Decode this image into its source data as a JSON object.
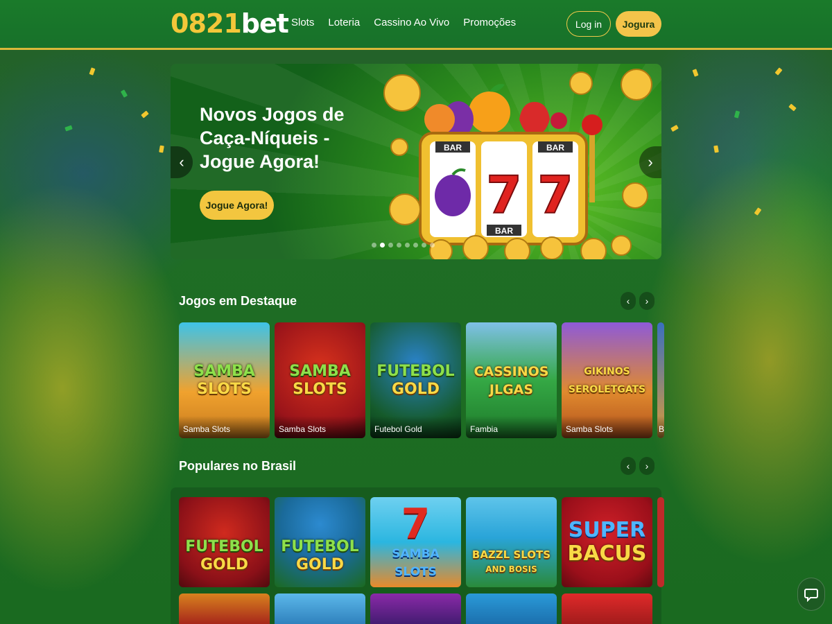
{
  "brand": {
    "logo_num": "0821",
    "logo_bet": "bet"
  },
  "nav": [
    "Slots",
    "Loteria",
    "Cassino Ao Vivo",
    "Promoções"
  ],
  "auth": {
    "login": "Log in",
    "signup": "Jogura"
  },
  "hero": {
    "title": "Novos Jogos de Caça-Níqueis - Jogue Agora!",
    "cta": "Jogue Agora!",
    "slide_count": 8,
    "active_slide": 1,
    "reel_labels": [
      "BAR",
      "BAR",
      "BAR"
    ],
    "reel_symbols": [
      "plum-icon",
      "7",
      "7"
    ]
  },
  "sections": {
    "featured": {
      "title": "Jogos em Destaque",
      "games": [
        {
          "name": "Samba Slots",
          "art": [
            "SAMBA",
            "SLOTS"
          ],
          "bg": "#f0a22e"
        },
        {
          "name": "Samba Slots",
          "art": [
            "SAMBA",
            "SLOTS"
          ],
          "bg": "#a91d1d"
        },
        {
          "name": "Futebol Gold",
          "art": [
            "FUTEBOL",
            "GOLD"
          ],
          "bg": "#1c7a2a"
        },
        {
          "name": "Fambia",
          "art": [
            "CASSINOS",
            "JLGAS"
          ],
          "bg": "#2aa845"
        },
        {
          "name": "Samba Slots",
          "art": [
            "GIKINOS",
            "SEROLETGATS"
          ],
          "bg": "#d96a2a"
        },
        {
          "name": "B",
          "art": [],
          "bg": "#3a6fc0"
        }
      ]
    },
    "popular": {
      "title": "Populares no Brasil",
      "games": [
        {
          "art": [
            "FUTEBOL",
            "GOLD"
          ],
          "bg": "#a5141e"
        },
        {
          "art": [
            "FUTEBOL",
            "GOLD"
          ],
          "bg": "#1a6aa0"
        },
        {
          "art": [
            "SAMBA SLOTS"
          ],
          "bg": "#2bb6e0"
        },
        {
          "art": [
            "BAZZL SLOTS",
            "AND BOSIS"
          ],
          "bg": "#29a4d8"
        },
        {
          "art": [
            "SUPER",
            "BACUS"
          ],
          "bg": "#b51621"
        }
      ]
    }
  },
  "colors": {
    "accent": "#f3c44a",
    "header": "#17712a",
    "page": "#1d6b22"
  },
  "icons": {
    "chat": "chat-icon",
    "prev": "chevron-left-icon",
    "next": "chevron-right-icon"
  }
}
